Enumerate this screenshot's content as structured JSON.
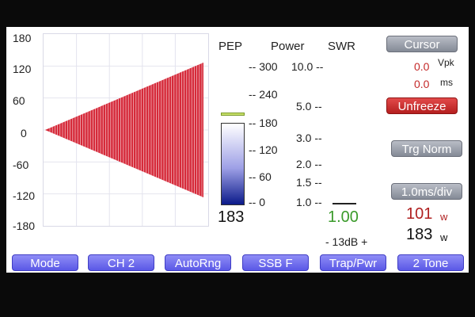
{
  "scope": {
    "y_ticks": [
      "180",
      "120",
      "60",
      "0",
      "-60",
      "-120",
      "-180"
    ]
  },
  "meters": {
    "headers": {
      "pep": "PEP",
      "power": "Power",
      "swr": "SWR"
    },
    "power_scale": [
      "-- 300",
      "-- 240",
      "-- 180",
      "-- 120",
      "-- 60",
      "-- 0"
    ],
    "swr_scale": [
      "10.0 --",
      "5.0 --",
      "3.0 --",
      "2.0 --",
      "1.5 --",
      "1.0 --"
    ],
    "pep_value": "183",
    "pep_fill_fraction": 0.61,
    "swr_value": "1.00",
    "attenuation": "- 13dB +"
  },
  "sidebar": {
    "cursor_label": "Cursor",
    "vpk_value": "0.0",
    "vpk_unit": "Vpk",
    "ms_value": "0.0",
    "ms_unit": "ms",
    "unfreeze_label": "Unfreeze",
    "trigger_label": "Trg Norm",
    "timebase_label": "1.0ms/div",
    "avg_power": "101",
    "avg_unit": "w",
    "peak_power": "183",
    "peak_unit": "w"
  },
  "bottom_buttons": [
    "Mode",
    "CH 2",
    "AutoRng",
    "SSB F",
    "Trap/Pwr",
    "2 Tone"
  ],
  "colors": {
    "trace": "#d62a3a",
    "pep_marker": "#a8c84a",
    "swr_value": "#3a9a2a",
    "avg_power": "#b02020",
    "button_blue": "#6d6bee",
    "button_gray": "#9aa0ab",
    "button_red": "#c42828"
  }
}
